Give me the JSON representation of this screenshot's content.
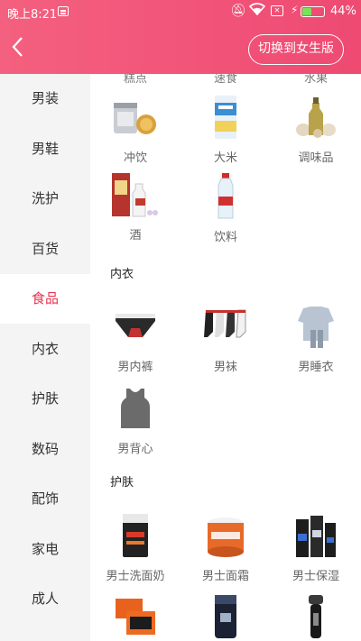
{
  "status_bar": {
    "time": "晚上8:21",
    "sim_label": "✕",
    "battery_percent": "44%",
    "battery_level": 0.44
  },
  "header": {
    "back_icon": "chevron-left-icon",
    "switch_label": "切换到女生版"
  },
  "sidebar": {
    "active_index": 4,
    "items": [
      {
        "label": "男装"
      },
      {
        "label": "男鞋"
      },
      {
        "label": "洗护"
      },
      {
        "label": "百货"
      },
      {
        "label": "食品"
      },
      {
        "label": "内衣"
      },
      {
        "label": "护肤"
      },
      {
        "label": "数码"
      },
      {
        "label": "配饰"
      },
      {
        "label": "家电"
      },
      {
        "label": "成人"
      }
    ]
  },
  "food": {
    "cut_labels": [
      "糕点",
      "速食",
      "水果"
    ],
    "items": [
      {
        "label": "冲饮",
        "icon": "tea-tin-icon"
      },
      {
        "label": "大米",
        "icon": "rice-bag-icon"
      },
      {
        "label": "调味品",
        "icon": "seasoning-icon"
      },
      {
        "label": "酒",
        "icon": "liquor-icon"
      },
      {
        "label": "饮料",
        "icon": "water-bottle-icon"
      }
    ]
  },
  "underwear": {
    "title": "内衣",
    "items": [
      {
        "label": "男内裤",
        "icon": "briefs-icon"
      },
      {
        "label": "男袜",
        "icon": "socks-icon"
      },
      {
        "label": "男睡衣",
        "icon": "pajamas-icon"
      },
      {
        "label": "男背心",
        "icon": "tank-top-icon"
      }
    ]
  },
  "skincare": {
    "title": "护肤",
    "items": [
      {
        "label": "男士洗面奶",
        "icon": "face-wash-icon"
      },
      {
        "label": "男士面霜",
        "icon": "face-cream-icon"
      },
      {
        "label": "男士保湿",
        "icon": "moisturizer-icon"
      },
      {
        "label": "",
        "icon": "face-mask-icon"
      },
      {
        "label": "",
        "icon": "cream-bottle-icon"
      },
      {
        "label": "",
        "icon": "shaver-icon"
      }
    ]
  }
}
